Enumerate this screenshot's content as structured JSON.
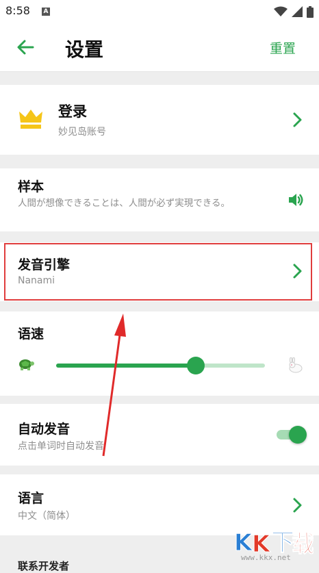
{
  "status_bar": {
    "time": "8:58",
    "notification_letter": "A",
    "icons": [
      "wifi-icon",
      "signal-icon",
      "battery-icon"
    ]
  },
  "header": {
    "back_icon": "back-arrow-icon",
    "title": "设置",
    "reset_label": "重置"
  },
  "login": {
    "icon": "crown-icon",
    "title": "登录",
    "subtitle": "妙见岛账号"
  },
  "sample": {
    "title": "样本",
    "text": "人間が想像できることは、人間が必ず実現できる。",
    "icon": "speaker-icon"
  },
  "engine": {
    "title": "发音引擎",
    "value": "Nanami"
  },
  "speed": {
    "title": "语速",
    "slow_icon": "turtle-icon",
    "fast_icon": "rabbit-icon",
    "level": 0.67
  },
  "auto_pronounce": {
    "title": "自动发音",
    "subtitle": "点击单词时自动发音",
    "enabled": true
  },
  "language": {
    "title": "语言",
    "value": "中文（简体）"
  },
  "contact": {
    "title": "联系开发者"
  },
  "watermark": {
    "url": "www.kkx.net"
  },
  "colors": {
    "accent": "#2aa44f",
    "highlight": "#e03c3c",
    "background": "#eeeeee"
  }
}
